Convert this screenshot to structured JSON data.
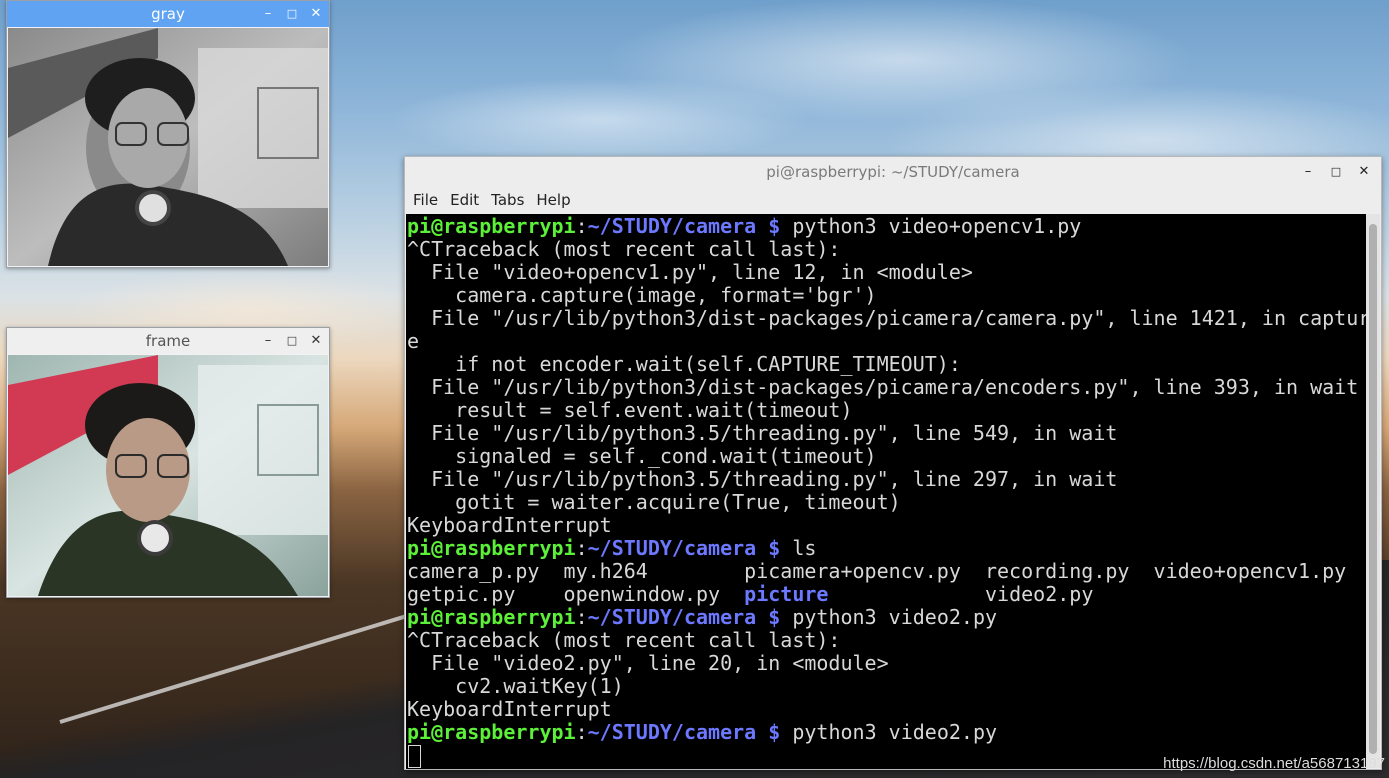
{
  "gray_window": {
    "title": "gray",
    "min_glyph": "–",
    "max_glyph": "□",
    "close_glyph": "✕"
  },
  "frame_window": {
    "title": "frame",
    "min_glyph": "–",
    "max_glyph": "□",
    "close_glyph": "✕"
  },
  "terminal": {
    "title": "pi@raspberrypi: ~/STUDY/camera",
    "min_glyph": "–",
    "max_glyph": "□",
    "close_glyph": "✕",
    "menu": [
      "File",
      "Edit",
      "Tabs",
      "Help"
    ],
    "prompt_user": "pi@raspberrypi",
    "prompt_sep": ":",
    "prompt_path": "~/STUDY/camera",
    "prompt_dollar": " $",
    "lines": {
      "l0_cmd": " python3 video+opencv1.py",
      "l1": "^CTraceback (most recent call last):",
      "l2": "  File \"video+opencv1.py\", line 12, in <module>",
      "l3": "    camera.capture(image, format='bgr')",
      "l4": "  File \"/usr/lib/python3/dist-packages/picamera/camera.py\", line 1421, in captur",
      "l5": "e",
      "l6": "    if not encoder.wait(self.CAPTURE_TIMEOUT):",
      "l7": "  File \"/usr/lib/python3/dist-packages/picamera/encoders.py\", line 393, in wait",
      "l8": "    result = self.event.wait(timeout)",
      "l9": "  File \"/usr/lib/python3.5/threading.py\", line 549, in wait",
      "l10": "    signaled = self._cond.wait(timeout)",
      "l11": "  File \"/usr/lib/python3.5/threading.py\", line 297, in wait",
      "l12": "    gotit = waiter.acquire(True, timeout)",
      "l13": "KeyboardInterrupt",
      "l14_cmd": " ls",
      "l15": "camera_p.py  my.h264        picamera+opencv.py  recording.py  video+opencv1.py",
      "l16_a": "getpic.py    openwindow.py  ",
      "l16_dir": "picture",
      "l16_b": "             video2.py",
      "l17_cmd": " python3 video2.py",
      "l18": "^CTraceback (most recent call last):",
      "l19": "  File \"video2.py\", line 20, in <module>",
      "l20": "    cv2.waitKey(1)",
      "l21": "KeyboardInterrupt",
      "l22_cmd": " python3 video2.py"
    }
  },
  "watermark": "https://blog.csdn.net/a568713197",
  "colors": {
    "active_titlebar": "#5fa3f2",
    "prompt_green": "#5cf038",
    "prompt_blue": "#6c78ff",
    "terminal_bg": "#000000"
  }
}
